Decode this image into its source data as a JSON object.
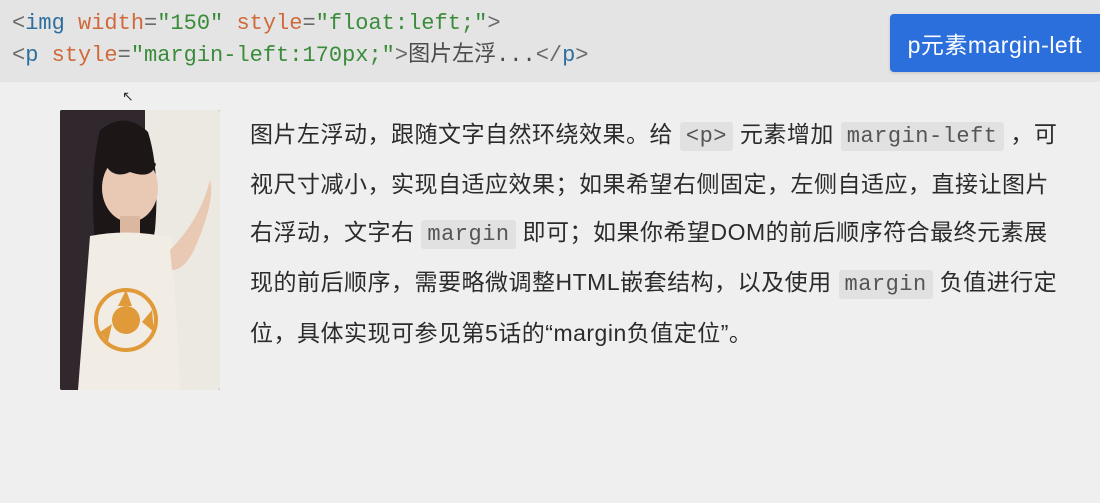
{
  "code": {
    "line1": {
      "lt": "<",
      "tag": "img",
      "sp": " ",
      "attr1": "width",
      "eq": "=",
      "val1": "\"150\"",
      "attr2": "style",
      "val2": "\"float:left;\"",
      "gt": ">"
    },
    "line2": {
      "lt": "<",
      "tag": "p",
      "sp": " ",
      "attr1": "style",
      "eq": "=",
      "val1": "\"margin-left:170px;\"",
      "gt": ">",
      "content": "图片左浮...",
      "clt": "</",
      "ctag": "p",
      "cgt": ">"
    }
  },
  "button_label": "p元素margin-left",
  "paragraph": {
    "t1": "图片左浮动，跟随文字自然环绕效果。给 ",
    "c1": "<p>",
    "t2": " 元素增加 ",
    "c2": "margin-left",
    "t3": " ，可视尺寸减小，实现自适应效果；如果希望右侧固定，左侧自适应，直接让图片右浮动，文字右 ",
    "c3": "margin",
    "t4": " 即可；如果你希望DOM的前后顺序符合最终元素展现的前后顺序，需要略微调整HTML嵌套结构，以及使用 ",
    "c4": "margin",
    "t5": " 负值进行定位，具体实现可参见第5话的“margin负值定位”。"
  }
}
